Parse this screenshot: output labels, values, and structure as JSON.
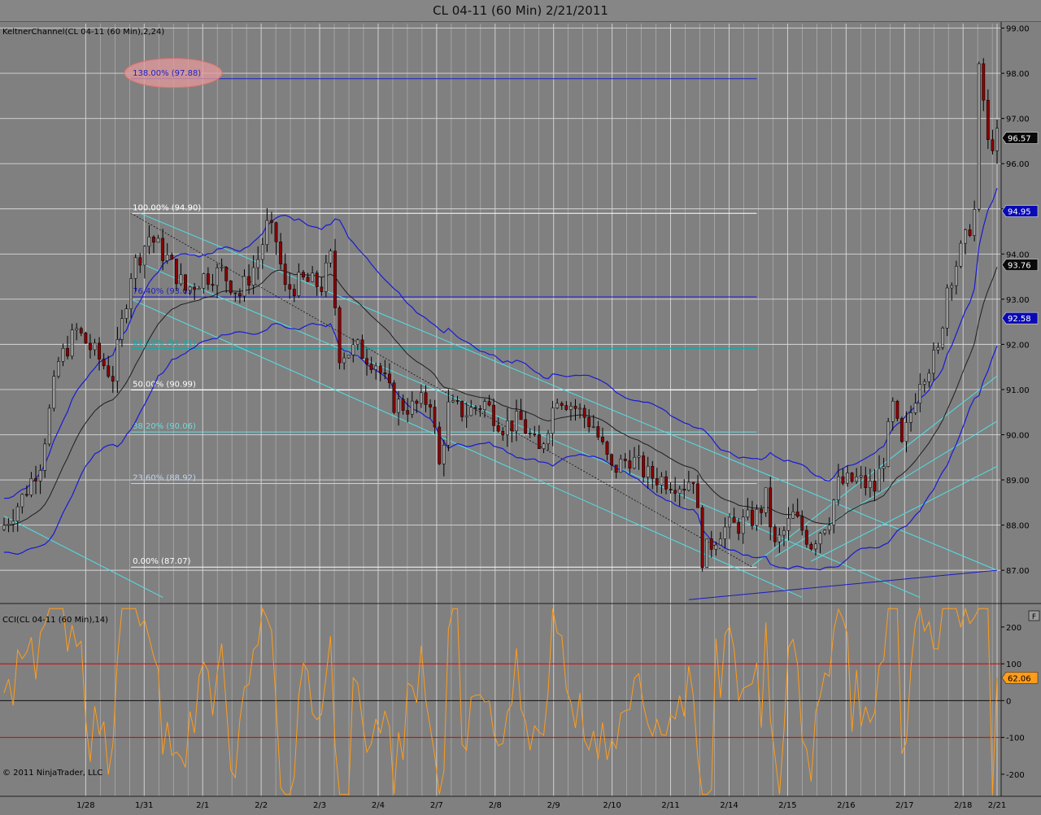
{
  "window": {
    "title": "CL 04-11 (60 Min)  2/21/2011"
  },
  "panels": {
    "price_label": "KeltnerChannel(CL 04-11 (60 Min),2,24)",
    "cci_label": "CCI(CL 04-11 (60 Min),14)",
    "copyright": "© 2011 NinjaTrader, LLC",
    "panel_button": "F"
  },
  "colors": {
    "background": "#808080",
    "keltner_band": "#1a1ad6",
    "keltner_mid": "#1e1e1e",
    "channel": "#4fe0e6",
    "fib_blue": "#1a1aa0",
    "cci": "#ff9c1a",
    "cci_level": "#d40000",
    "up_candle": "#9a9a9a",
    "down_candle": "#8a0000"
  },
  "chart_data": [
    {
      "type": "candlestick",
      "title": "CL 04-11 (60 Min)  2/21/2011",
      "x_tick_labels": [
        "1/28",
        "1/31",
        "2/1",
        "2/2",
        "2/3",
        "2/4",
        "2/7",
        "2/8",
        "2/9",
        "2/10",
        "2/11",
        "2/14",
        "2/15",
        "2/16",
        "2/17",
        "2/18",
        "2/21"
      ],
      "ylim": [
        86.3,
        99.1
      ],
      "y_ticks": [
        87.0,
        88.0,
        89.0,
        90.0,
        91.0,
        92.0,
        93.0,
        94.0,
        95.0,
        96.0,
        97.0,
        98.0,
        99.0
      ],
      "y_tick_labels": [
        "87.00",
        "88.00",
        "89.00",
        "90.00",
        "91.00",
        "92.00",
        "93.00",
        "94.00",
        "95.00",
        "96.00",
        "97.00",
        "98.00",
        "99.00"
      ],
      "price_path": [
        [
          0,
          88.0
        ],
        [
          4,
          88.6
        ],
        [
          8,
          89.4
        ],
        [
          12,
          91.6
        ],
        [
          16,
          92.3
        ],
        [
          20,
          91.8
        ],
        [
          24,
          91.3
        ],
        [
          28,
          93.6
        ],
        [
          32,
          94.4
        ],
        [
          36,
          93.9
        ],
        [
          40,
          93.2
        ],
        [
          44,
          93.5
        ],
        [
          48,
          93.6
        ],
        [
          52,
          93.1
        ],
        [
          56,
          93.9
        ],
        [
          58,
          94.6
        ],
        [
          60,
          94.3
        ],
        [
          62,
          93.2
        ],
        [
          66,
          93.4
        ],
        [
          70,
          93.3
        ],
        [
          72,
          93.9
        ],
        [
          74,
          91.8
        ],
        [
          78,
          91.9
        ],
        [
          82,
          91.6
        ],
        [
          86,
          90.7
        ],
        [
          90,
          90.6
        ],
        [
          94,
          90.8
        ],
        [
          96,
          89.3
        ],
        [
          98,
          90.6
        ],
        [
          102,
          90.5
        ],
        [
          106,
          90.7
        ],
        [
          110,
          90.2
        ],
        [
          114,
          90.3
        ],
        [
          118,
          89.6
        ],
        [
          122,
          90.9
        ],
        [
          126,
          90.6
        ],
        [
          130,
          90.2
        ],
        [
          134,
          89.2
        ],
        [
          138,
          89.5
        ],
        [
          142,
          89.1
        ],
        [
          146,
          89.0
        ],
        [
          150,
          88.9
        ],
        [
          152,
          89.1
        ],
        [
          154,
          87.3
        ],
        [
          158,
          87.9
        ],
        [
          162,
          88.0
        ],
        [
          166,
          88.2
        ],
        [
          168,
          88.6
        ],
        [
          170,
          87.5
        ],
        [
          174,
          88.2
        ],
        [
          178,
          87.6
        ],
        [
          182,
          88.2
        ],
        [
          184,
          88.9
        ],
        [
          188,
          89.0
        ],
        [
          192,
          88.8
        ],
        [
          194,
          89.5
        ],
        [
          196,
          90.6
        ],
        [
          198,
          89.7
        ],
        [
          200,
          90.5
        ],
        [
          202,
          91.3
        ],
        [
          206,
          91.8
        ],
        [
          208,
          93.3
        ],
        [
          212,
          94.3
        ],
        [
          214,
          94.95
        ],
        [
          215,
          98.0
        ],
        [
          216,
          97.4
        ],
        [
          217,
          96.4
        ],
        [
          219,
          96.57
        ]
      ],
      "fib_levels": [
        {
          "label": "138.00% (97.88)",
          "value": 97.88,
          "color": "#2020c8",
          "highlight": true
        },
        {
          "label": "100.00% (94.90)",
          "value": 94.9,
          "color": "#ffffff"
        },
        {
          "label": "76.40% (93.05)",
          "value": 93.05,
          "color": "#2020c8"
        },
        {
          "label": "61.80% (91.91)",
          "value": 91.91,
          "color": "#14a8a8"
        },
        {
          "label": "50.00% (90.99)",
          "value": 90.99,
          "color": "#ffffff"
        },
        {
          "label": "38.20% (90.06)",
          "value": 90.06,
          "color": "#6edcdc"
        },
        {
          "label": "23.60% (88.92)",
          "value": 88.92,
          "color": "#c0d6ee"
        },
        {
          "label": "0.00% (87.07)",
          "value": 87.07,
          "color": "#ffffff"
        }
      ],
      "price_tags": [
        {
          "label": "96.57",
          "value": 96.57,
          "style": "black"
        },
        {
          "label": "94.95",
          "value": 94.95,
          "style": "blue"
        },
        {
          "label": "93.76",
          "value": 93.76,
          "style": "black"
        },
        {
          "label": "92.58",
          "value": 92.58,
          "style": "blue"
        }
      ]
    },
    {
      "type": "line",
      "title": "CCI(CL 04-11 (60 Min),14)",
      "ylim": [
        -260,
        255
      ],
      "y_ticks": [
        -200,
        -100,
        0,
        100,
        200
      ],
      "y_tick_labels": [
        "-200",
        "-100",
        "0",
        "100",
        "200"
      ],
      "levels": [
        100,
        0,
        -100
      ],
      "last_value_label": "62.06",
      "last_value": 62.06
    }
  ]
}
